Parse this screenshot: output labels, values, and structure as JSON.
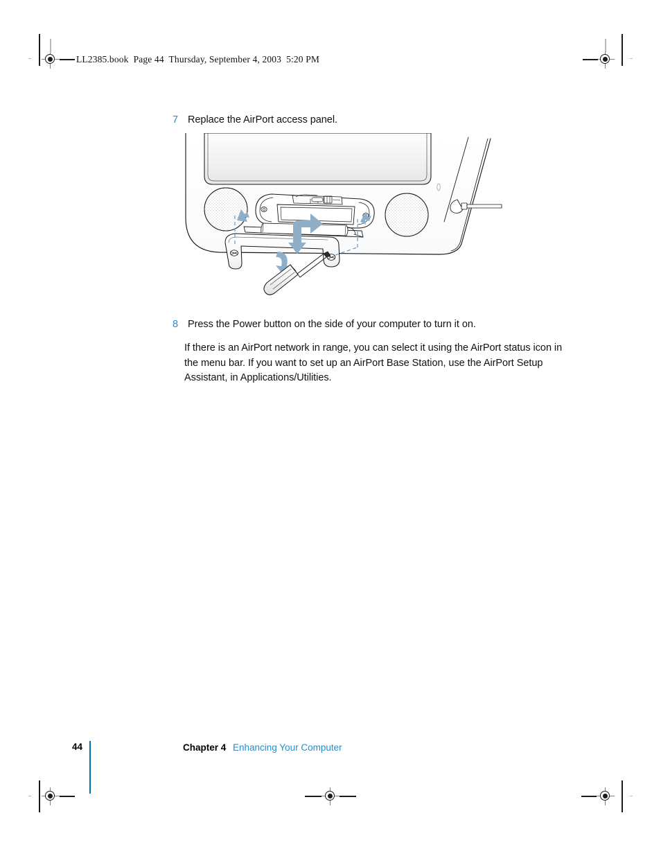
{
  "document": {
    "running_header": "LL2385.book  Page 44  Thursday, September 4, 2003  5:20 PM",
    "page_number": "44"
  },
  "body": {
    "steps": [
      {
        "number": "7",
        "text": "Replace the AirPort access panel."
      },
      {
        "number": "8",
        "text": "Press the Power button on the side of your computer to turn it on."
      }
    ],
    "paragraph": "If there is an AirPort network in range, you can select it using the AirPort status icon in the menu bar. If you want to set up an AirPort Base Station, use the AirPort Setup Assistant, in Applications/Utilities."
  },
  "figure": {
    "caption": "Line illustration of the bottom of the computer showing the AirPort access panel, retaining bracket, two captive screws, and a screwdriver turning the right screw",
    "elements": [
      "computer-enclosure",
      "display-bezel",
      "left-speaker-grille",
      "right-speaker-grille",
      "airport-access-panel",
      "airport-card-slot",
      "panel-bracket",
      "left-captive-screw",
      "right-captive-screw",
      "screwdriver",
      "antenna-cable",
      "insert-arrow",
      "left-align-arrow",
      "right-align-arrow",
      "screw-turn-arrow",
      "alignment-dashed-guides"
    ]
  },
  "footer": {
    "page_number": "44",
    "chapter_label": "Chapter 4",
    "chapter_title": "Enhancing Your Computer"
  },
  "print_marks": {
    "registration_mark_label": "registration-mark",
    "count": "5"
  },
  "colors": {
    "accent_blue": "#2a8cc8",
    "rule_blue": "#0071b5",
    "arrow_blue": "#8aa9c4",
    "text_black": "#111111",
    "line_art": "#1a1a1a"
  }
}
